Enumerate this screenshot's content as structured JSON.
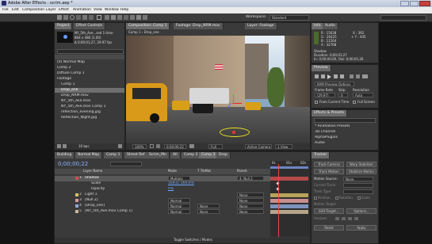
{
  "titlebar": {
    "title": "Adobe After Effects - scrim.aep *"
  },
  "menu": [
    "File",
    "Edit",
    "Composition",
    "Layer",
    "Effect",
    "Animation",
    "View",
    "Window",
    "Help"
  ],
  "workspace": {
    "label": "Workspace:",
    "value": "Standard"
  },
  "project": {
    "tabs": [
      "Project",
      "Effect Controls"
    ],
    "info_name": "NY_5th_Ave...sed 1 time",
    "info_lines": [
      "864 x 486 (1.00)",
      "Δ 0;00;01;27, 29.97 fps"
    ],
    "items": [
      "(0) Normal Map",
      "Comp 2",
      "Diffuse Comp 1",
      "Footage",
      "Comp 1",
      "Drop_one",
      "Drop_NRM.mov",
      "NY_5th_Ave.mov",
      "NY_5th_Ave.mov Comp 1",
      "reflection_evening.jpg",
      "Reflection_Night.jpg"
    ],
    "footer_bpc": "16 bpc"
  },
  "viewer": {
    "tabs": [
      "Composition: Comp 1",
      "Footage: Drop_NRM.mov",
      "Layer: Footage"
    ],
    "breadcrumb": "Comp 1 ‹ Drop_one",
    "zoom": "100%",
    "timecode": "0;00;00;22",
    "quality": "Full",
    "camera": "Active Camera",
    "view": "1 View"
  },
  "info": {
    "tabs": [
      "Info",
      "Audio"
    ],
    "r": "R : 15638",
    "g": "G : 26425",
    "b": "B : 11564",
    "a": "A : 32768",
    "x": "X : 392",
    "y": "+ Y : 445",
    "name": "Shadow",
    "duration": "Duration: 0;00;01;27",
    "in": "In: 0;00;00;00, Out: 0;00;01;26"
  },
  "preview": {
    "tab": "Preview",
    "ram": "RAM Preview Options",
    "labels": [
      "Frame Rate",
      "Skip",
      "Resolution"
    ],
    "values": [
      "(29.97)",
      "0",
      "Auto"
    ],
    "from_current": "From Current Time",
    "full_screen": "Full Screen"
  },
  "effects": {
    "tab": "Effects & Presets",
    "search_placeholder": "",
    "items": [
      "* Animation Presets",
      "3D Channel",
      "AlphaPlugins",
      "Audio"
    ]
  },
  "timeline": {
    "tabs": [
      "Building",
      "Normal Map",
      "Comp 1",
      "Street Ref",
      "Scrim_Mn",
      "All",
      "Comp 2",
      "Comp 3",
      "Drop"
    ],
    "timecode": "0;00;00;22",
    "columns": [
      "Layer Name",
      "Mode",
      "T TrkMat",
      "Parent"
    ],
    "layers": [
      {
        "num": "1",
        "name": "Shadow",
        "mode": "Multiply",
        "trk": "",
        "parent": "4. Null 2",
        "color": "#c94f4f"
      },
      {
        "num": "",
        "name": "Scale",
        "mode": "169.0, 169.0%",
        "trk": "",
        "parent": "",
        "color": "#c94f4f"
      },
      {
        "num": "",
        "name": "Opacity",
        "mode": "0%",
        "trk": "",
        "parent": "",
        "color": "#c94f4f"
      },
      {
        "num": "2",
        "name": "Light 1",
        "mode": "",
        "trk": "",
        "parent": "None",
        "color": "#d6c06a"
      },
      {
        "num": "3",
        "name": "[Null 2]",
        "mode": "Normal",
        "trk": "",
        "parent": "None",
        "color": "#d89a9a"
      },
      {
        "num": "4",
        "name": "[Drop_one]",
        "mode": "Normal",
        "trk": "None",
        "parent": "None",
        "color": "#8fa8d4"
      },
      {
        "num": "5",
        "name": "[NY_5th_Ave.mov Comp 1]",
        "mode": "Normal",
        "trk": "None",
        "parent": "None",
        "color": "#c8b79a"
      }
    ],
    "toggle": "Toggle Switches / Modes",
    "ruler": [
      "0s",
      "01s",
      "02s"
    ]
  },
  "tracker": {
    "tab": "Tracker",
    "track_camera": "Track Camera",
    "warp": "Warp Stabilizer",
    "track_motion": "Track Motion",
    "stabilize": "Stabilize Motion",
    "source_label": "Motion Source:",
    "source_value": "None",
    "current_track": "Current Track:",
    "track_type": "Track Type:",
    "checks": [
      "Position",
      "Rotation",
      "Scale"
    ],
    "target": "Motion Target:",
    "edit_target": "Edit Target...",
    "options": "Options...",
    "analyze": "Analyze:",
    "reset": "Reset",
    "apply": "Apply"
  }
}
